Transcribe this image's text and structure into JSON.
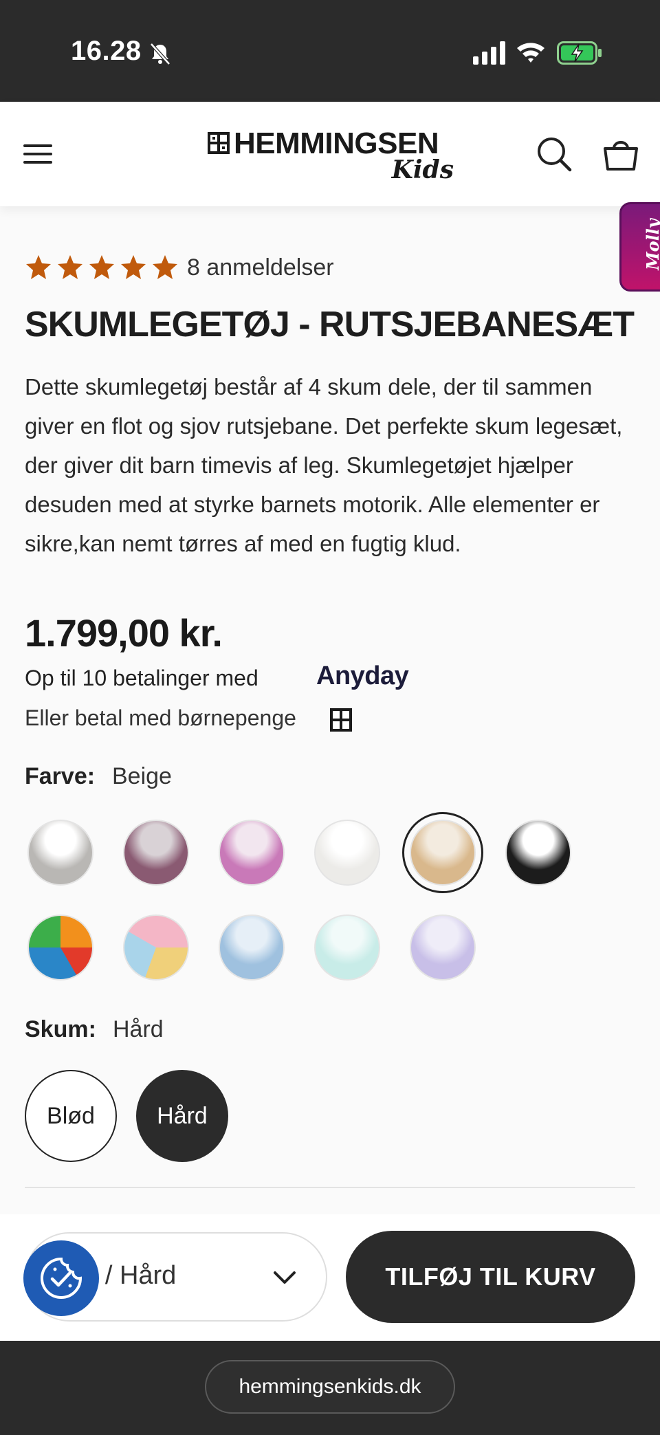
{
  "status_bar": {
    "time": "16.28"
  },
  "header": {
    "logo_name": "HEMMINGSEN",
    "logo_sub": "Kids"
  },
  "molly": {
    "label": "Molly"
  },
  "product": {
    "rating_stars": 5,
    "review_count": "8 anmeldelser",
    "title": "SKUMLEGETØJ - RUTSJEBANESÆT",
    "description": "Dette skumlegetøj består af 4 skum dele, der til sammen giver en flot og sjov rutsjebane. Det perfekte skum legesæt, der giver dit barn timevis af leg. Skumlegetøjet hjælper desuden med at styrke barnets motorik. Alle elementer er sikre,kan nemt tørres af med en fugtig klud.",
    "price": "1.799,00 kr.",
    "installments": "Op til 10 betalinger med",
    "installments_provider": "Anyday",
    "childmoney": "Eller betal med børnepenge"
  },
  "color": {
    "label": "Farve:",
    "value": "Beige",
    "swatches": [
      {
        "name": "photo",
        "fill": "#b9b7b4",
        "accent": "#ffffff"
      },
      {
        "name": "plum",
        "fill": "#8a5a72",
        "accent": "#d9d2d6"
      },
      {
        "name": "pink",
        "fill": "#c979b8",
        "accent": "#f2e6ef"
      },
      {
        "name": "white",
        "fill": "#ecebe8",
        "accent": "#ffffff"
      },
      {
        "name": "beige",
        "fill": "#d9b88c",
        "accent": "#f3ebdf",
        "selected": true
      },
      {
        "name": "black",
        "fill": "#1c1c1c",
        "accent": "#ffffff"
      },
      {
        "name": "multicolor",
        "fill": "#f2901c",
        "accent": "#2a86c8"
      },
      {
        "name": "pastel",
        "fill": "#f0d07a",
        "accent": "#f4b6c6"
      },
      {
        "name": "blue",
        "fill": "#9fc1df",
        "accent": "#e6eff7"
      },
      {
        "name": "mint",
        "fill": "#c8ece8",
        "accent": "#f1faf9"
      },
      {
        "name": "lavender",
        "fill": "#c8bfe8",
        "accent": "#efedf8"
      }
    ]
  },
  "foam": {
    "label": "Skum:",
    "value": "Hård",
    "options": [
      "Blød",
      "Hård"
    ]
  },
  "sticky": {
    "variant_text": "ge / Hård",
    "add_to_cart": "TILFØJ TIL KURV"
  },
  "browser": {
    "url": "hemmingsenkids.dk"
  },
  "colors": {
    "star": "#c05a0c",
    "dark": "#2b2b2b",
    "cookie_blue": "#1f5bb4"
  }
}
